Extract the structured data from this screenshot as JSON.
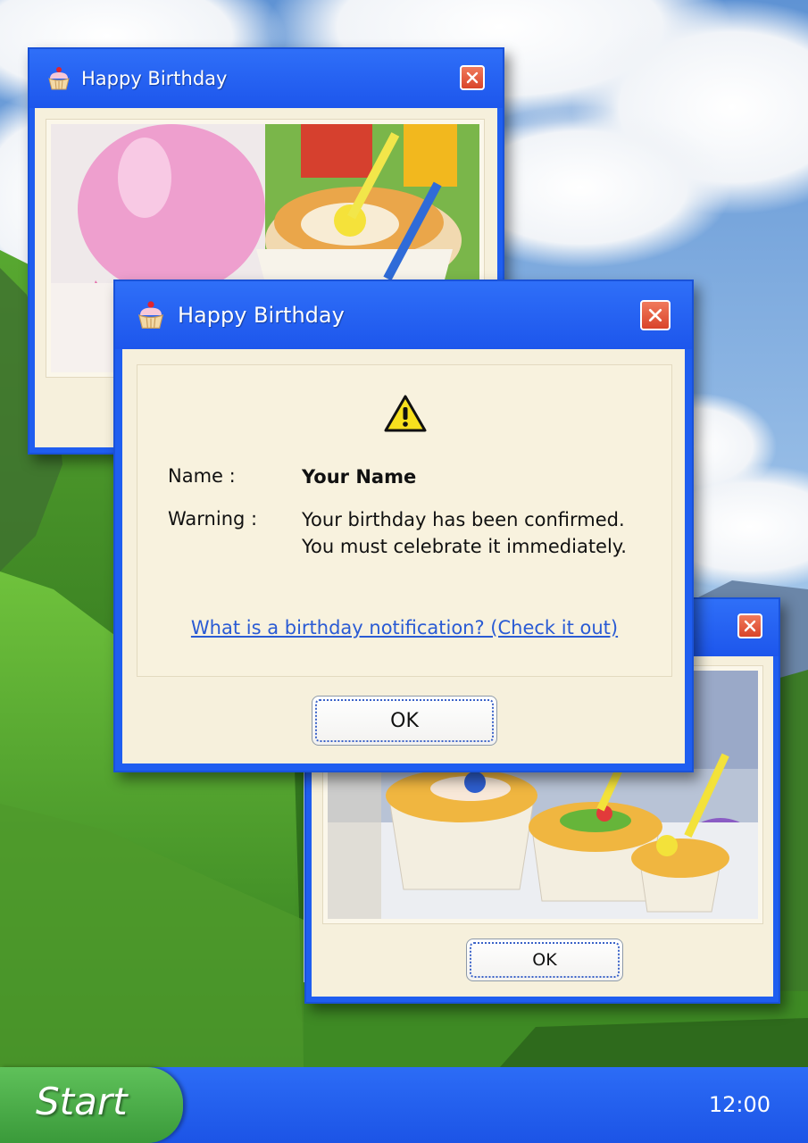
{
  "desktop": {
    "wallpaper": "mountain-meadow-sky"
  },
  "windows": {
    "back_top": {
      "title": "Happy Birthday",
      "icon": "cupcake-icon",
      "photo": "balloon-and-cupcakes-photo"
    },
    "dialog": {
      "title": "Happy Birthday",
      "icon": "cupcake-icon",
      "alert_icon": "warning-icon",
      "name_label": "Name :",
      "name_value": "Your Name",
      "warning_label": "Warning :",
      "warning_line1": "Your birthday has been confirmed.",
      "warning_line2": "You must celebrate it immediately.",
      "help_link": "What is a birthday notification? (Check it out)",
      "ok_label": "OK"
    },
    "back_bottom": {
      "title": "",
      "photo": "cupcakes-with-candles-photo",
      "ok_label": "OK"
    }
  },
  "taskbar": {
    "start_label": "Start",
    "clock": "12:00"
  },
  "colors": {
    "window_blue": "#1f5ef0",
    "client_cream": "#f6f0dc",
    "close_red": "#e0553a",
    "link_blue": "#2a5bd4",
    "start_green": "#4caf4a"
  }
}
